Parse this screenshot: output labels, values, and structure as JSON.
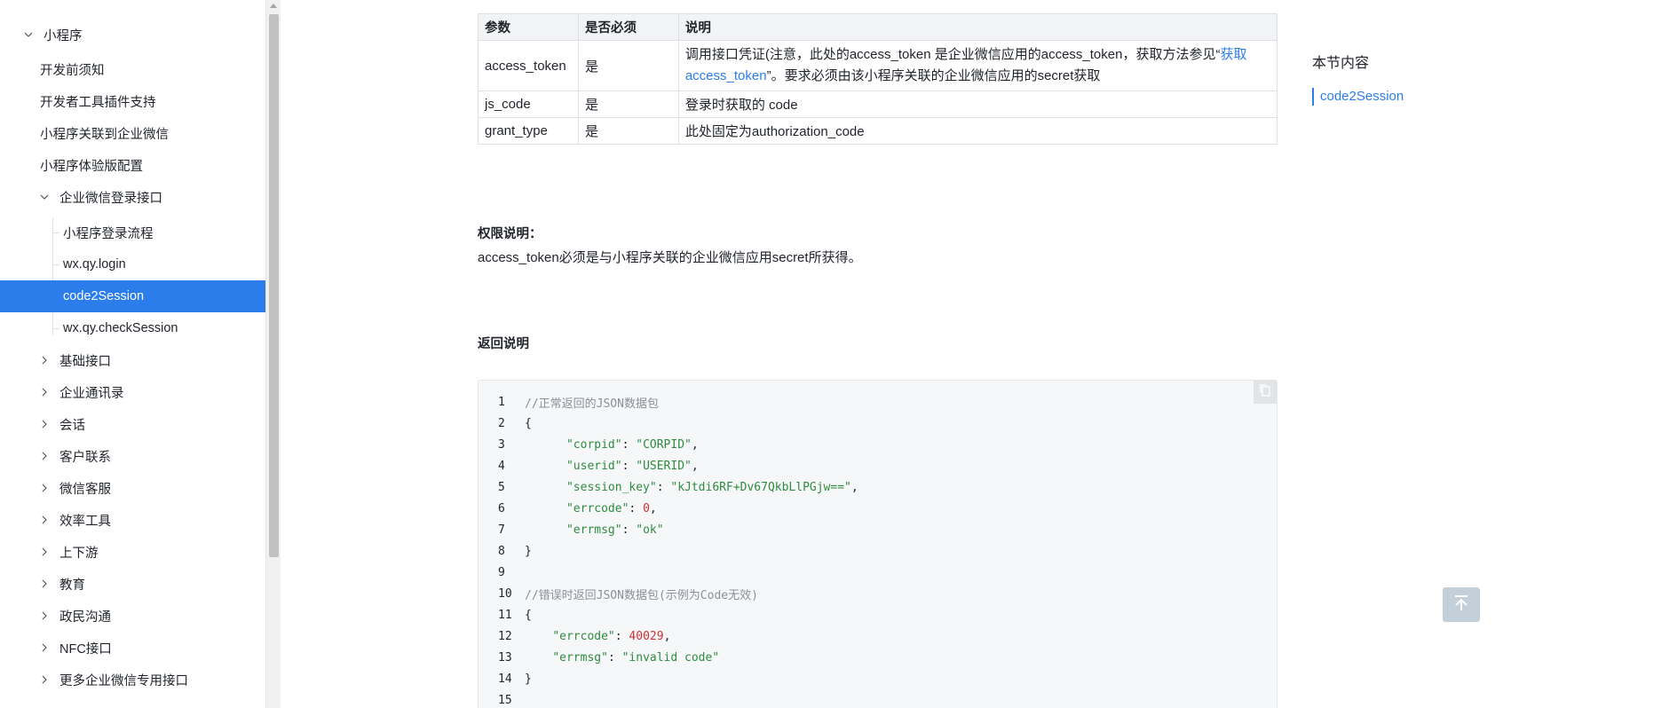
{
  "sidebar": {
    "items": [
      {
        "label": "小程序",
        "chevron": "down"
      },
      {
        "label": "开发前须知"
      },
      {
        "label": "开发者工具插件支持"
      },
      {
        "label": "小程序关联到企业微信"
      },
      {
        "label": "小程序体验版配置"
      },
      {
        "label": "企业微信登录接口",
        "chevron": "down"
      },
      {
        "label": "小程序登录流程"
      },
      {
        "label": "wx.qy.login"
      },
      {
        "label": "code2Session",
        "active": true
      },
      {
        "label": "wx.qy.checkSession"
      },
      {
        "label": "基础接口",
        "chevron": "right"
      },
      {
        "label": "企业通讯录",
        "chevron": "right"
      },
      {
        "label": "会话",
        "chevron": "right"
      },
      {
        "label": "客户联系",
        "chevron": "right"
      },
      {
        "label": "微信客服",
        "chevron": "right"
      },
      {
        "label": "效率工具",
        "chevron": "right"
      },
      {
        "label": "上下游",
        "chevron": "right"
      },
      {
        "label": "教育",
        "chevron": "right"
      },
      {
        "label": "政民沟通",
        "chevron": "right"
      },
      {
        "label": "NFC接口",
        "chevron": "right"
      },
      {
        "label": "更多企业微信专用接口",
        "chevron": "right"
      }
    ]
  },
  "params_table": {
    "headers": [
      "参数",
      "是否必须",
      "说明"
    ],
    "rows": [
      {
        "name": "access_token",
        "required": "是",
        "desc_before": "调用接口凭证(注意，此处的access_token 是企业微信应用的access_token，获取方法参见“",
        "desc_link": "获取access_token",
        "desc_after": "”。要求必须由该小程序关联的企业微信应用的secret获取"
      },
      {
        "name": "js_code",
        "required": "是",
        "desc": "登录时获取的 code"
      },
      {
        "name": "grant_type",
        "required": "是",
        "desc": "此处固定为authorization_code"
      }
    ]
  },
  "permission": {
    "title": "权限说明：",
    "text": "access_token必须是与小程序关联的企业微信应用secret所获得。"
  },
  "return_section": {
    "title": "返回说明"
  },
  "code_block": {
    "lines": [
      {
        "n": "1",
        "parts": [
          {
            "t": "//正常返回的JSON数据包",
            "c": "cc"
          }
        ]
      },
      {
        "n": "2",
        "parts": [
          {
            "t": "{",
            "c": "cp"
          }
        ]
      },
      {
        "n": "3",
        "parts": [
          {
            "t": "      ",
            "c": "cp"
          },
          {
            "t": "\"corpid\"",
            "c": "ck"
          },
          {
            "t": ": ",
            "c": "cp"
          },
          {
            "t": "\"CORPID\"",
            "c": "cs"
          },
          {
            "t": ",",
            "c": "cp"
          }
        ]
      },
      {
        "n": "4",
        "parts": [
          {
            "t": "      ",
            "c": "cp"
          },
          {
            "t": "\"userid\"",
            "c": "ck"
          },
          {
            "t": ": ",
            "c": "cp"
          },
          {
            "t": "\"USERID\"",
            "c": "cs"
          },
          {
            "t": ",",
            "c": "cp"
          }
        ]
      },
      {
        "n": "5",
        "parts": [
          {
            "t": "      ",
            "c": "cp"
          },
          {
            "t": "\"session_key\"",
            "c": "ck"
          },
          {
            "t": ": ",
            "c": "cp"
          },
          {
            "t": "\"kJtdi6RF+Dv67QkbLlPGjw==\"",
            "c": "cs"
          },
          {
            "t": ",",
            "c": "cp"
          }
        ]
      },
      {
        "n": "6",
        "parts": [
          {
            "t": "      ",
            "c": "cp"
          },
          {
            "t": "\"errcode\"",
            "c": "ck"
          },
          {
            "t": ": ",
            "c": "cp"
          },
          {
            "t": "0",
            "c": "cn"
          },
          {
            "t": ",",
            "c": "cp"
          }
        ]
      },
      {
        "n": "7",
        "parts": [
          {
            "t": "      ",
            "c": "cp"
          },
          {
            "t": "\"errmsg\"",
            "c": "ck"
          },
          {
            "t": ": ",
            "c": "cp"
          },
          {
            "t": "\"ok\"",
            "c": "cs"
          }
        ]
      },
      {
        "n": "8",
        "parts": [
          {
            "t": "}",
            "c": "cp"
          }
        ]
      },
      {
        "n": "9",
        "parts": []
      },
      {
        "n": "10",
        "parts": [
          {
            "t": "//错误时返回JSON数据包(示例为Code无效)",
            "c": "cc"
          }
        ]
      },
      {
        "n": "11",
        "parts": [
          {
            "t": "{",
            "c": "cp"
          }
        ]
      },
      {
        "n": "12",
        "parts": [
          {
            "t": "    ",
            "c": "cp"
          },
          {
            "t": "\"errcode\"",
            "c": "ck"
          },
          {
            "t": ": ",
            "c": "cp"
          },
          {
            "t": "40029",
            "c": "cn"
          },
          {
            "t": ",",
            "c": "cp"
          }
        ]
      },
      {
        "n": "13",
        "parts": [
          {
            "t": "    ",
            "c": "cp"
          },
          {
            "t": "\"errmsg\"",
            "c": "ck"
          },
          {
            "t": ": ",
            "c": "cp"
          },
          {
            "t": "\"invalid code\"",
            "c": "cs"
          }
        ]
      },
      {
        "n": "14",
        "parts": [
          {
            "t": "}",
            "c": "cp"
          }
        ]
      },
      {
        "n": "15",
        "parts": []
      }
    ]
  },
  "toc": {
    "title": "本节内容",
    "items": [
      "code2Session"
    ]
  },
  "colors": {
    "accent": "#2b7dec",
    "back_top": "#c3cfd9"
  }
}
